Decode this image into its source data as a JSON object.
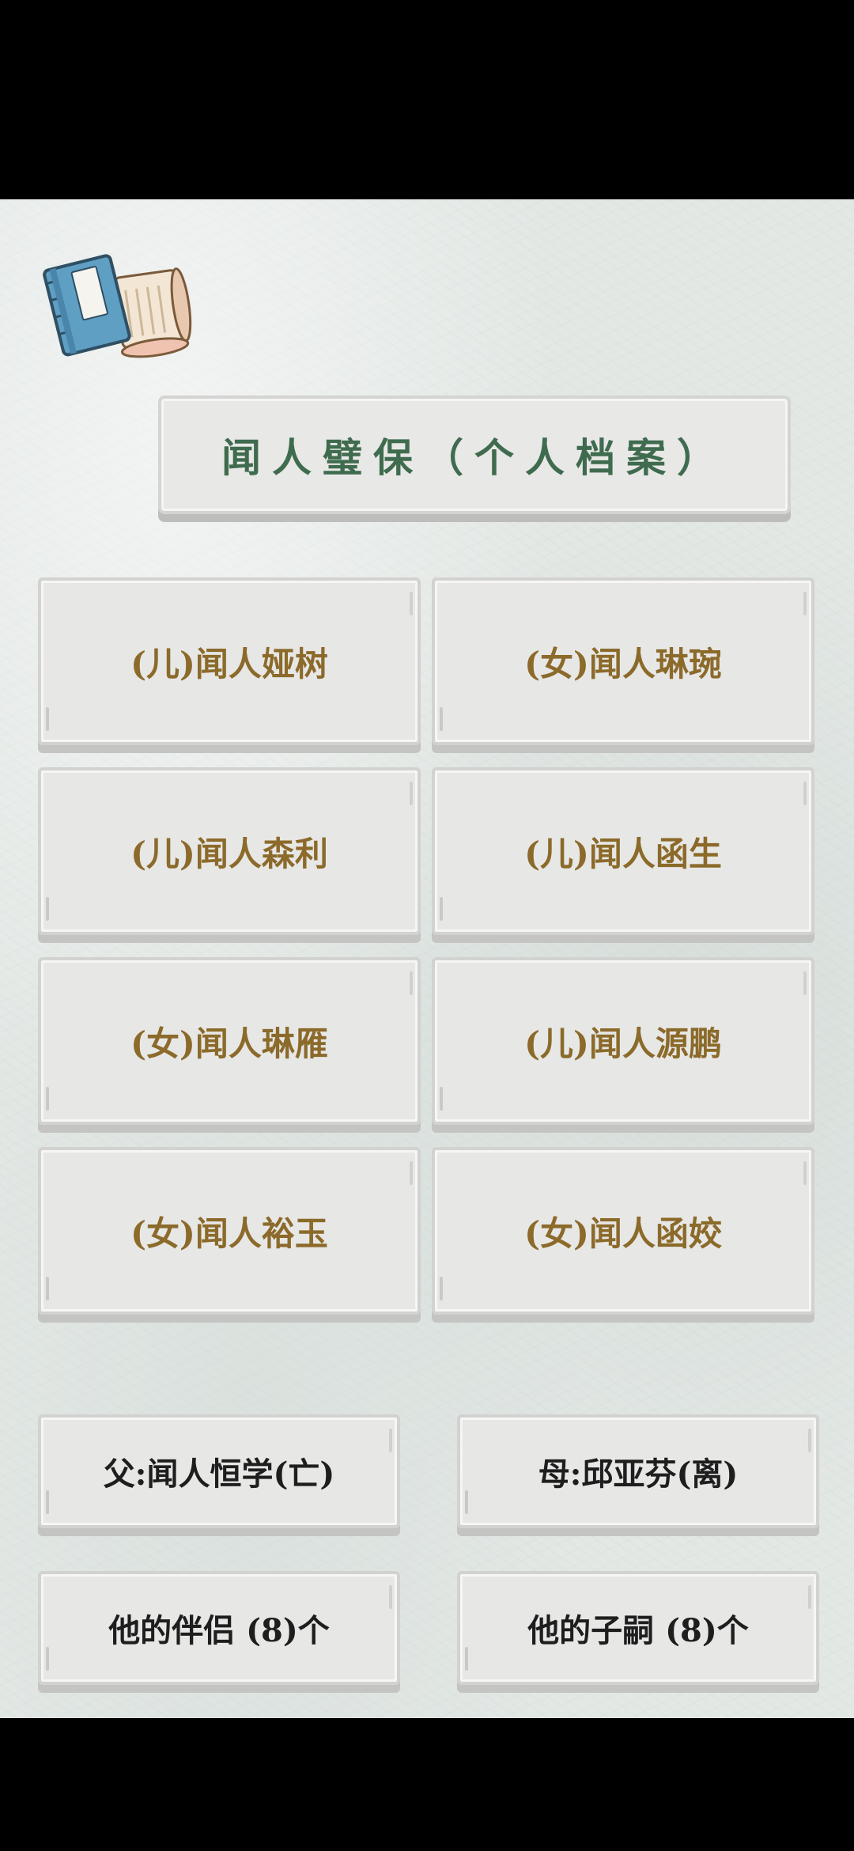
{
  "title": "闻人璧保（个人档案）",
  "icons": {
    "book": "open-book-scroll-icon"
  },
  "children": [
    {
      "label": "(儿)闻人娅树"
    },
    {
      "label": "(女)闻人琳琬"
    },
    {
      "label": "(儿)闻人森利"
    },
    {
      "label": "(儿)闻人函生"
    },
    {
      "label": "(女)闻人琳雁"
    },
    {
      "label": "(儿)闻人源鹏"
    },
    {
      "label": "(女)闻人裕玉"
    },
    {
      "label": "(女)闻人函姣"
    }
  ],
  "family": {
    "father": "父:闻人恒学(亡)",
    "mother": "母:邱亚芬(离)",
    "partners": "他的伴侣 (8)个",
    "offspring": "他的子嗣 (8)个"
  },
  "colors": {
    "title_text": "#3f6b4e",
    "child_text": "#8b6a2a",
    "family_text": "#1e1e1e",
    "card_bg": "#e7e7e6",
    "paper_bg": "#e3e8e5"
  }
}
